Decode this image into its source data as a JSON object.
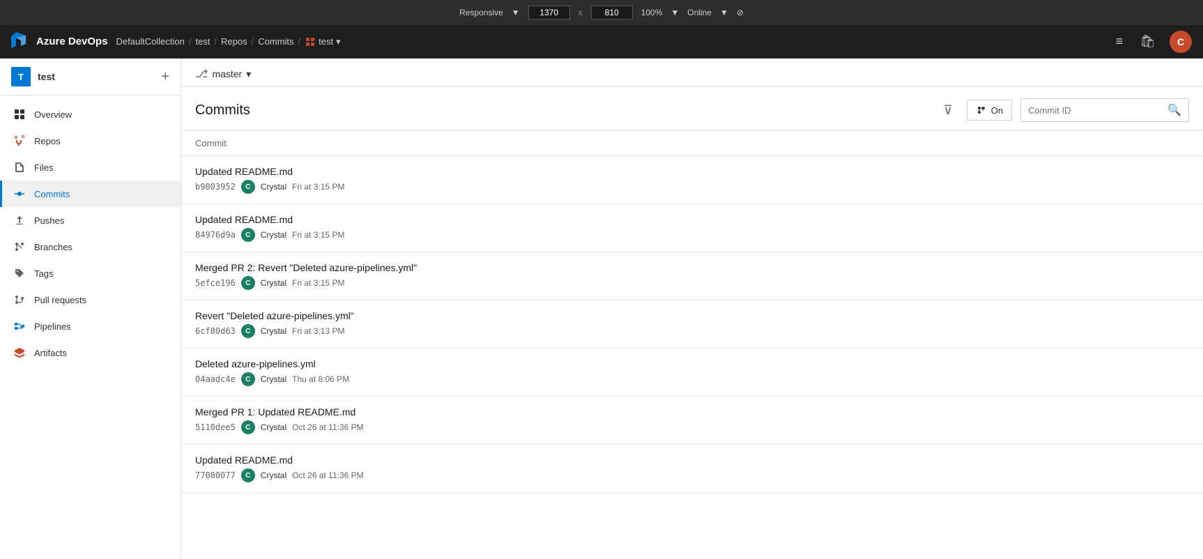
{
  "browser": {
    "responsive_label": "Responsive",
    "width": "1370",
    "x_label": "x",
    "height": "810",
    "zoom": "100%",
    "online": "Online"
  },
  "header": {
    "logo_text": "Azure DevOps",
    "breadcrumb": [
      {
        "label": "DefaultCollection",
        "link": true
      },
      {
        "label": "test",
        "link": true
      },
      {
        "label": "Repos",
        "link": true
      },
      {
        "label": "Commits",
        "link": true
      }
    ],
    "repo_name": "test",
    "user_initial": "C"
  },
  "sidebar": {
    "project_name": "test",
    "project_initial": "T",
    "add_label": "+",
    "nav_items": [
      {
        "label": "Overview",
        "icon": "overview",
        "active": false
      },
      {
        "label": "Repos",
        "icon": "repos",
        "active": false
      },
      {
        "label": "Files",
        "icon": "files",
        "active": false
      },
      {
        "label": "Commits",
        "icon": "commits",
        "active": true
      },
      {
        "label": "Pushes",
        "icon": "pushes",
        "active": false
      },
      {
        "label": "Branches",
        "icon": "branches",
        "active": false
      },
      {
        "label": "Tags",
        "icon": "tags",
        "active": false
      },
      {
        "label": "Pull requests",
        "icon": "pulls",
        "active": false
      },
      {
        "label": "Pipelines",
        "icon": "pipelines",
        "active": false
      },
      {
        "label": "Artifacts",
        "icon": "artifacts",
        "active": false
      }
    ]
  },
  "branch": {
    "name": "master"
  },
  "page": {
    "title": "Commits",
    "on_label": "On",
    "commit_id_placeholder": "Commit ID",
    "table_header": "Commit"
  },
  "commits": [
    {
      "message": "Updated README.md",
      "hash": "b9803952",
      "author": "Crystal",
      "author_initial": "C",
      "time": "Fri at 3:15 PM"
    },
    {
      "message": "Updated README.md",
      "hash": "84976d9a",
      "author": "Crystal",
      "author_initial": "C",
      "time": "Fri at 3:15 PM"
    },
    {
      "message": "Merged PR 2: Revert \"Deleted azure-pipelines.yml\"",
      "hash": "5efce196",
      "author": "Crystal",
      "author_initial": "C",
      "time": "Fri at 3:15 PM"
    },
    {
      "message": "Revert \"Deleted azure-pipelines.yml\"",
      "hash": "6cf80d63",
      "author": "Crystal",
      "author_initial": "C",
      "time": "Fri at 3:13 PM"
    },
    {
      "message": "Deleted azure-pipelines.yml",
      "hash": "04aadc4e",
      "author": "Crystal",
      "author_initial": "C",
      "time": "Thu at 8:06 PM"
    },
    {
      "message": "Merged PR 1: Updated README.md",
      "hash": "5110dee5",
      "author": "Crystal",
      "author_initial": "C",
      "time": "Oct 26 at 11:36 PM"
    },
    {
      "message": "Updated README.md",
      "hash": "77080077",
      "author": "Crystal",
      "author_initial": "C",
      "time": "Oct 26 at 11:36 PM"
    }
  ]
}
